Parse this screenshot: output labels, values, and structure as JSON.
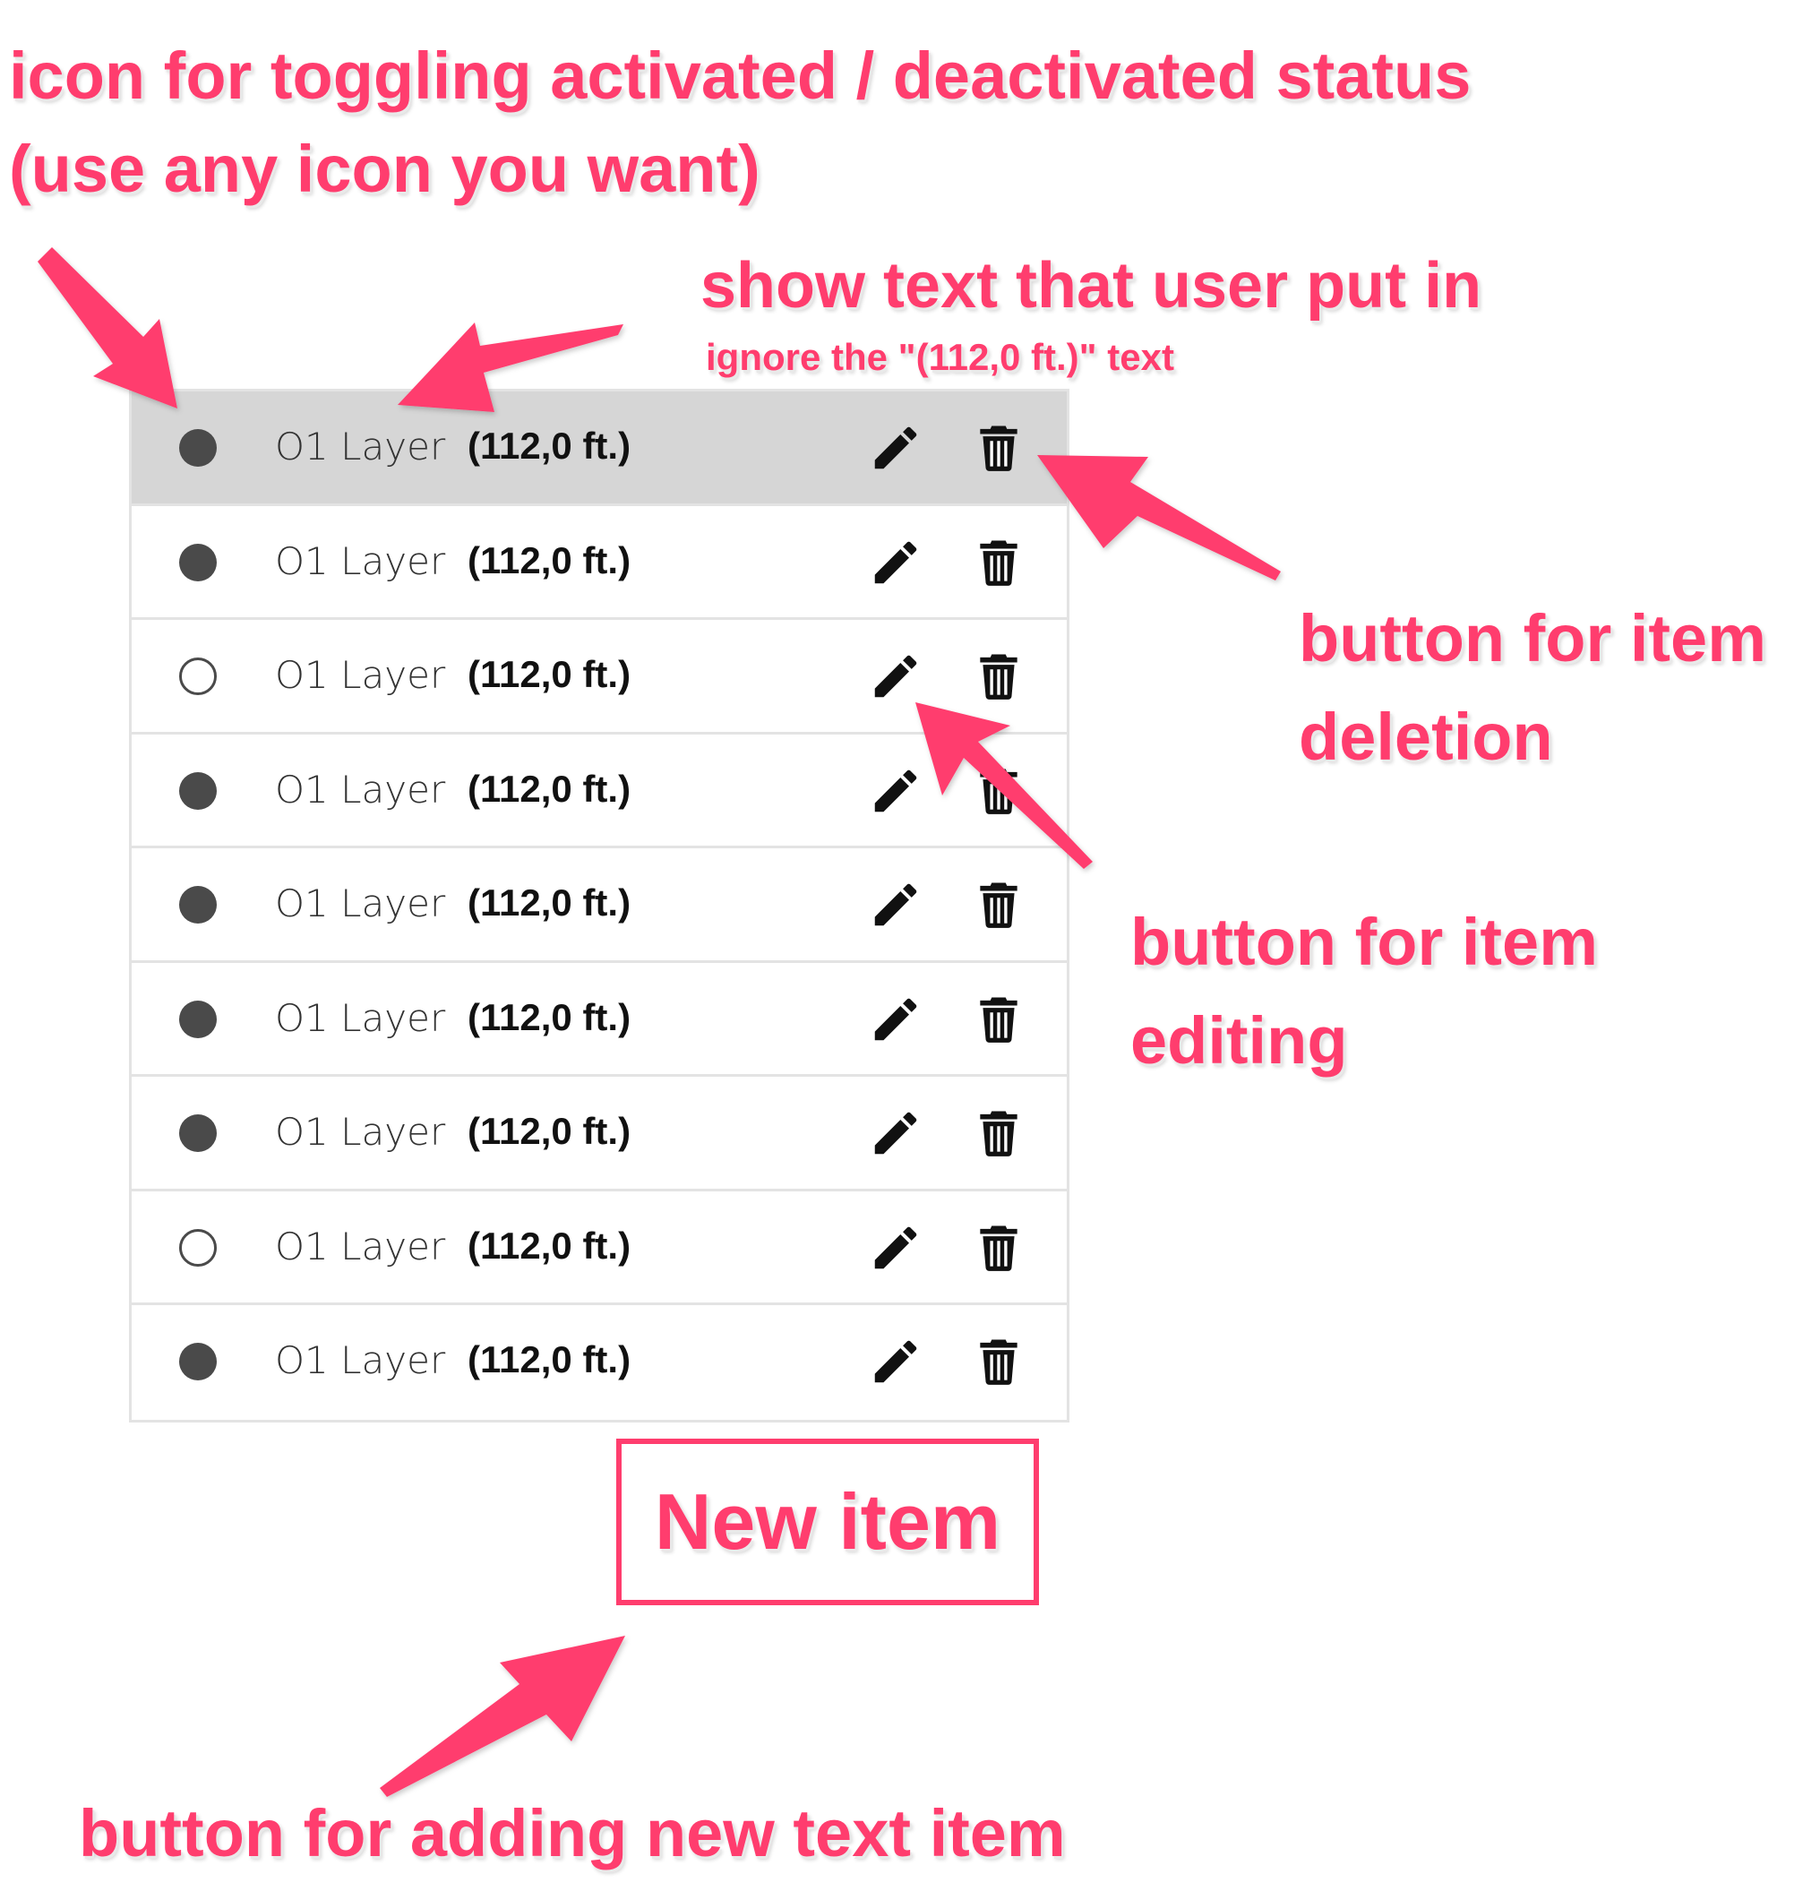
{
  "annotations": {
    "toggle_line1": "icon for toggling activated / deactivated status",
    "toggle_line2": "(use any icon you want)",
    "show_text": "show text that user put in",
    "ignore_text": "ignore the \"(112,0 ft.)\" text",
    "delete_line1": "button for item",
    "delete_line2": "deletion",
    "edit_line1": "button for item",
    "edit_line2": "editing",
    "add_text": "button for adding new text item"
  },
  "colors": {
    "accent": "#ff3d6e",
    "selected_row": "#d6d6d6",
    "status_dot": "#4a4a4a"
  },
  "list": {
    "items": [
      {
        "name": "O1 Layer",
        "dimension": "(112,0 ft.)",
        "active": true,
        "selected": true
      },
      {
        "name": "O1 Layer",
        "dimension": "(112,0 ft.)",
        "active": true,
        "selected": false
      },
      {
        "name": "O1 Layer",
        "dimension": "(112,0 ft.)",
        "active": false,
        "selected": false
      },
      {
        "name": "O1 Layer",
        "dimension": "(112,0 ft.)",
        "active": true,
        "selected": false
      },
      {
        "name": "O1 Layer",
        "dimension": "(112,0 ft.)",
        "active": true,
        "selected": false
      },
      {
        "name": "O1 Layer",
        "dimension": "(112,0 ft.)",
        "active": true,
        "selected": false
      },
      {
        "name": "O1 Layer",
        "dimension": "(112,0 ft.)",
        "active": true,
        "selected": false
      },
      {
        "name": "O1 Layer",
        "dimension": "(112,0 ft.)",
        "active": false,
        "selected": false
      },
      {
        "name": "O1 Layer",
        "dimension": "(112,0 ft.)",
        "active": true,
        "selected": false
      }
    ],
    "icons": {
      "status": "circle-icon",
      "edit": "pencil-icon",
      "delete": "trash-icon"
    }
  },
  "new_item_label": "New item"
}
